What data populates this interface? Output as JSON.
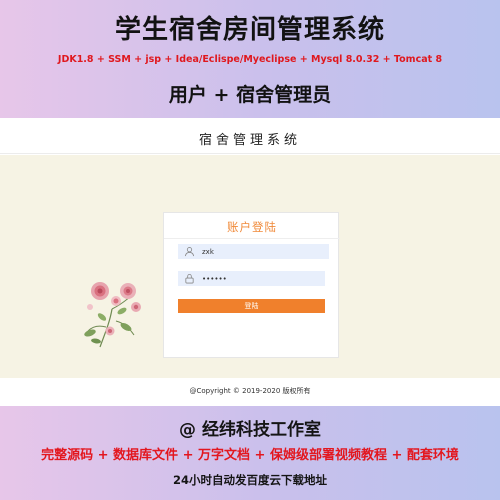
{
  "banner": {
    "title": "学生宿舍房间管理系统",
    "tech_stack": "JDK1.8 + SSM + jsp + Idea/Eclispe/Myeclipse + Mysql 8.0.32 + Tomcat 8",
    "roles": "用户 + 宿舍管理员"
  },
  "app": {
    "system_title": "宿舍管理系统",
    "login": {
      "title": "账户登陆",
      "username_value": "zxk",
      "password_value": "••••••",
      "submit_label": "登陆"
    },
    "copyright": "@Copyright © 2019-2020 版权所有"
  },
  "footer": {
    "studio": "@ 经纬科技工作室",
    "features": "完整源码 + 数据库文件 + 万字文档 + 保姆级部署视频教程 + 配套环境",
    "delivery": "24小时自动发百度云下载地址"
  },
  "colors": {
    "accent_orange": "#f0802c",
    "banner_red": "#e3171f",
    "page_beige": "#f6f3e4",
    "field_blue": "#e8effc"
  },
  "icons": {
    "username": "user-icon",
    "password": "lock-icon",
    "decoration": "flower-illustration"
  }
}
